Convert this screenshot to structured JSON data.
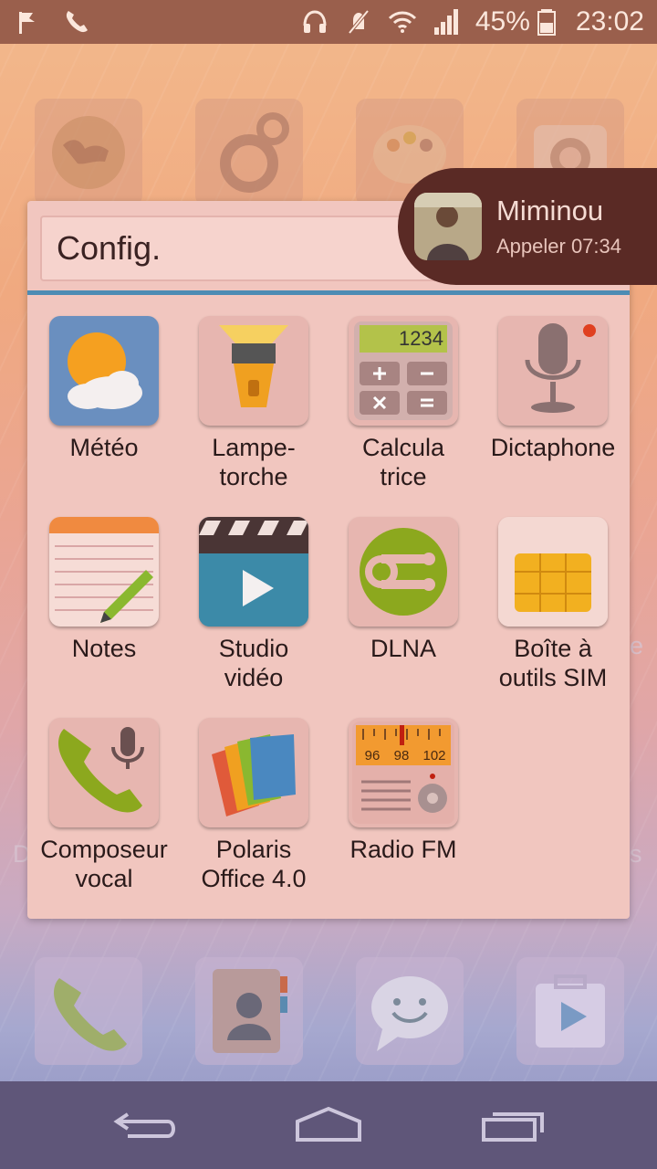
{
  "status_bar": {
    "battery": "45%",
    "time": "23:02",
    "icons_left": [
      "flag-icon",
      "phone-icon"
    ],
    "icons_right": [
      "headphones-icon",
      "mute-icon",
      "wifi-icon",
      "signal-icon",
      "battery-icon"
    ]
  },
  "folder": {
    "title": "Config.",
    "apps": [
      {
        "label": "Météo",
        "icon": "weather-icon"
      },
      {
        "label": "Lampe-\ntorche",
        "icon": "flashlight-icon"
      },
      {
        "label": "Calcula\ntrice",
        "icon": "calculator-icon"
      },
      {
        "label": "Dictaphone",
        "icon": "microphone-icon"
      },
      {
        "label": "Notes",
        "icon": "notes-icon"
      },
      {
        "label": "Studio\nvidéo",
        "icon": "video-studio-icon"
      },
      {
        "label": "DLNA",
        "icon": "dlna-icon"
      },
      {
        "label": "Boîte à\noutils SIM",
        "icon": "sim-card-icon"
      },
      {
        "label": "Composeur\nvocal",
        "icon": "voice-dialer-icon"
      },
      {
        "label": "Polaris\nOffice 4.0",
        "icon": "polaris-office-icon"
      },
      {
        "label": "Radio FM",
        "icon": "radio-icon"
      }
    ],
    "calculator_display": "1234",
    "radio_scale": [
      "96",
      "98",
      "102"
    ]
  },
  "notification": {
    "name": "Miminou",
    "subtitle": "Appeler 07:34"
  },
  "edge_labels": {
    "right_e": "e",
    "left_d": "D",
    "right_s": "s"
  },
  "colors": {
    "status_bar": "#9a5f4c",
    "folder_bg": "#f1c6bf",
    "accent_line": "#4d8cb4",
    "nav_bar": "#5f5679",
    "notification_bg": "#5a2a25"
  }
}
